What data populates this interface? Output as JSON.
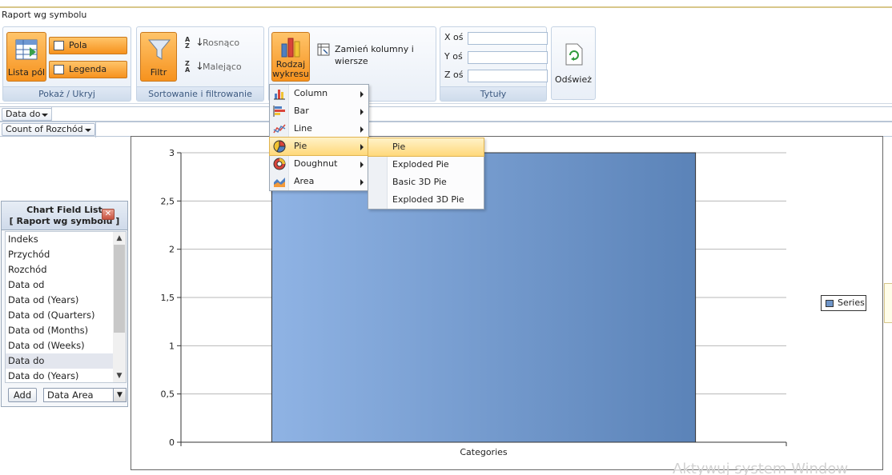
{
  "window": {
    "title": "Raport wg symbolu"
  },
  "ribbon": {
    "show_hide": {
      "label": "Pokaż / Ukryj",
      "field_list": "Lista pól",
      "fields": "Pola",
      "legend": "Legenda"
    },
    "sort_filter": {
      "label": "Sortowanie i filtrowanie",
      "filter": "Filtr",
      "ascending": "Rosnąco",
      "descending": "Malejąco"
    },
    "chart": {
      "chart_type": "Rodzaj wykresu",
      "swap": "Zamień kolumny i wiersze"
    },
    "titles": {
      "label": "Tytuły",
      "x_axis": "X oś",
      "y_axis": "Y oś",
      "z_axis": "Z oś",
      "x_value": "",
      "y_value": "",
      "z_value": ""
    },
    "refresh": "Odśwież"
  },
  "drop_zones": {
    "filter_field": "Data do",
    "data_field": "Count of Rozchód"
  },
  "field_list": {
    "title": "Chart Field List",
    "subtitle": "[ Raport wg symbolu ]",
    "items": [
      "Indeks",
      "Przychód",
      "Rozchód",
      "Data od",
      "Data od (Years)",
      "Data od (Quarters)",
      "Data od (Months)",
      "Data od (Weeks)",
      "Data do",
      "Data do (Years)"
    ],
    "selected": "Data do",
    "add_label": "Add",
    "area_value": "Data Area"
  },
  "chart_type_menu": {
    "items": [
      "Column",
      "Bar",
      "Line",
      "Pie",
      "Doughnut",
      "Area"
    ],
    "highlighted": "Pie"
  },
  "pie_submenu": {
    "items": [
      "Pie",
      "Exploded Pie",
      "Basic 3D Pie",
      "Exploded 3D Pie"
    ],
    "highlighted": "Pie"
  },
  "colors": {
    "accent": "#f6921e",
    "series": "#6e95c9",
    "header": "#cfdaea"
  },
  "chart_data": {
    "type": "bar",
    "categories": [
      "Categories"
    ],
    "series": [
      {
        "name": "Series",
        "values": [
          3
        ]
      }
    ],
    "ylim": [
      0,
      3
    ],
    "yticks": [
      0,
      0.5,
      1,
      1.5,
      2,
      2.5,
      3
    ],
    "ytick_labels": [
      "0",
      "0,5",
      "1",
      "1,5",
      "2",
      "2,5",
      "3"
    ],
    "grid": true,
    "legend": "right"
  },
  "status": {
    "watermark": "Aktywuj system Window"
  }
}
